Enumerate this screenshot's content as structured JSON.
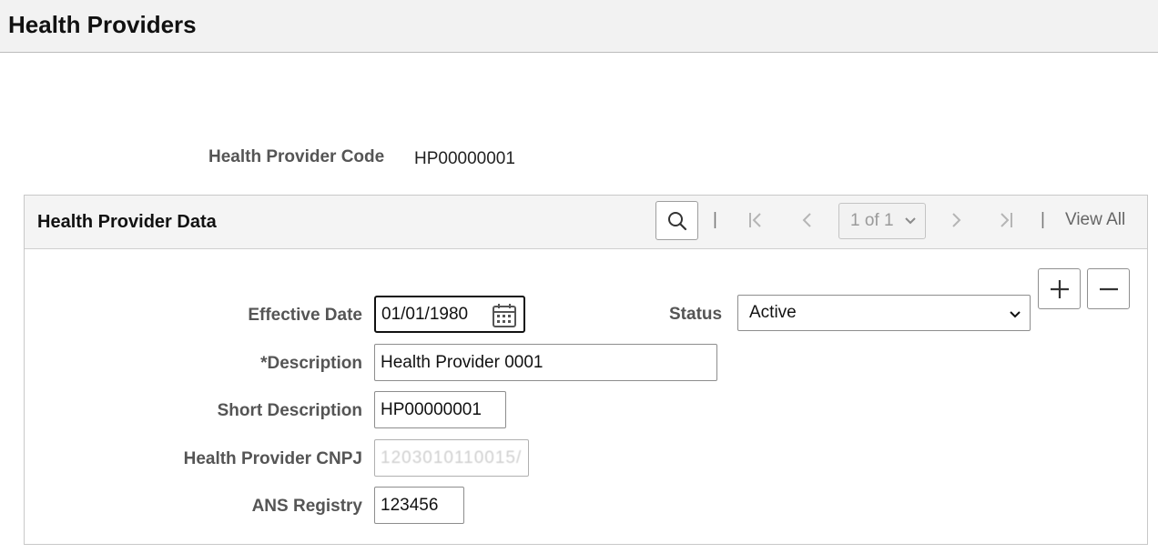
{
  "page": {
    "title": "Health Providers"
  },
  "key": {
    "code_label": "Health Provider Code",
    "code_value": "HP00000001"
  },
  "grid": {
    "title": "Health Provider Data",
    "pager_label": "1 of 1",
    "view_all": "View All",
    "separator": "|"
  },
  "fields": {
    "effective_date_label": "Effective Date",
    "effective_date_value": "01/01/1980",
    "status_label": "Status",
    "status_value": "Active",
    "description_label": "*Description",
    "description_value": "Health Provider 0001",
    "short_description_label": "Short Description",
    "short_description_value": "HP00000001",
    "cnpj_label": "Health Provider CNPJ",
    "cnpj_value": "1203010110015/",
    "ans_label": "ANS Registry",
    "ans_value": "123456"
  },
  "icons": {
    "search": "search-icon",
    "first": "first-page-icon",
    "prev": "previous-page-icon",
    "next": "next-page-icon",
    "last": "last-page-icon",
    "calendar": "calendar-icon",
    "add": "plus-icon",
    "delete": "minus-icon"
  },
  "colors": {
    "header_bg": "#f2f2f2",
    "label": "#555555",
    "border": "#8d8d8d"
  }
}
